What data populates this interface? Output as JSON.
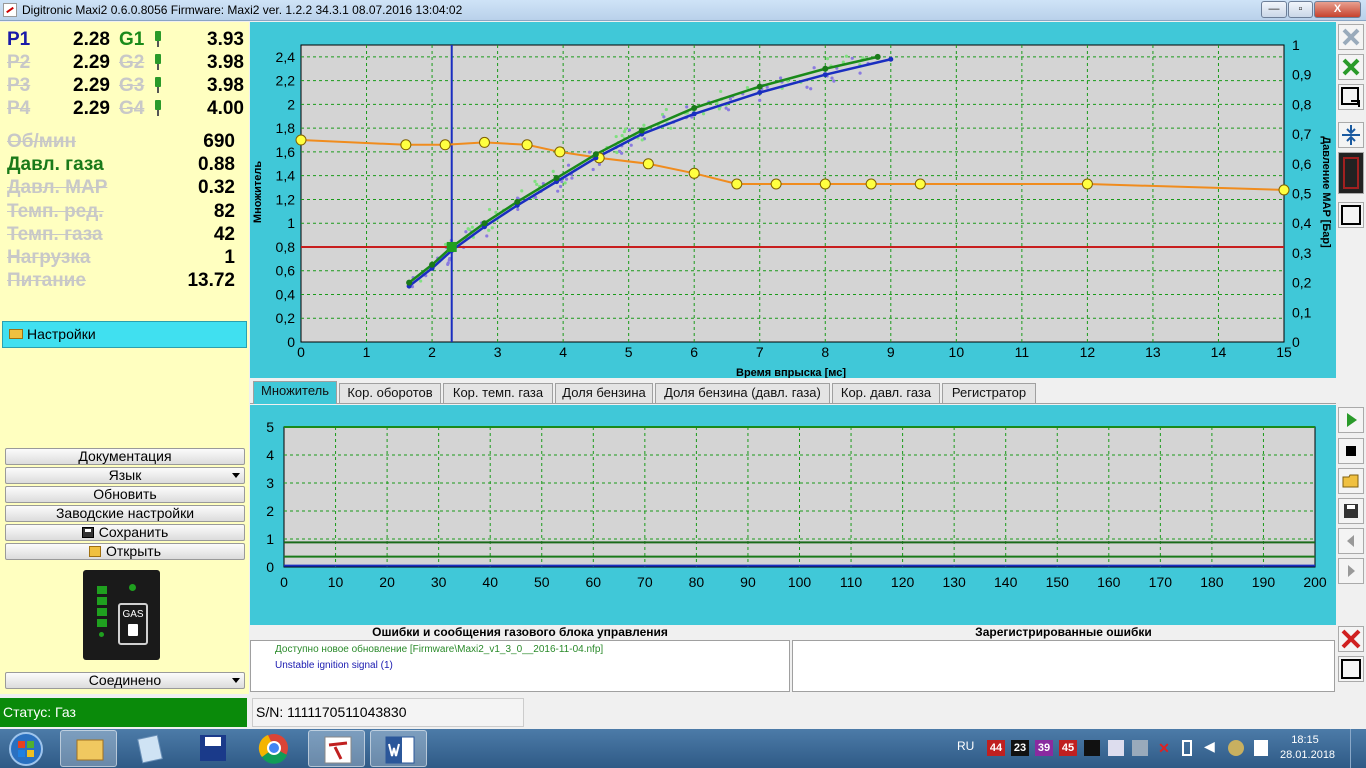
{
  "window": {
    "title": "Digitronic Maxi2 0.6.0.8056 Firmware: Maxi2  ver. 1.2.2  34.3.1  08.07.2016 13:04:02",
    "minimize": "—",
    "maximize": "▫",
    "close": "X"
  },
  "pressures": [
    {
      "label": "P1",
      "value": "2.28",
      "g_label": "G1",
      "g_value": "3.93"
    },
    {
      "label": "P2",
      "value": "2.29",
      "g_label": "G2",
      "g_value": "3.98"
    },
    {
      "label": "P3",
      "value": "2.29",
      "g_label": "G3",
      "g_value": "3.98"
    },
    {
      "label": "P4",
      "value": "2.29",
      "g_label": "G4",
      "g_value": "4.00"
    }
  ],
  "params": [
    {
      "label": "Об/мин",
      "value": "690"
    },
    {
      "label": "Давл. газа",
      "value": "0.88"
    },
    {
      "label": "Давл. MAP",
      "value": "0.32"
    },
    {
      "label": "Темп. ред.",
      "value": "82"
    },
    {
      "label": "Темп. газа",
      "value": "42"
    },
    {
      "label": "Нагрузка",
      "value": "1"
    },
    {
      "label": "Питание",
      "value": "13.72"
    }
  ],
  "settings_label": "Настройки",
  "buttons": {
    "docs": "Документация",
    "language": "Язык",
    "update": "Обновить",
    "factory": "Заводские настройки",
    "save": "Сохранить",
    "open": "Открыть",
    "connection": "Соединено"
  },
  "gas_switch_label": "GAS",
  "tabs": [
    "Множитель",
    "Кор. оборотов",
    "Кор. темп. газа",
    "Доля бензина",
    "Доля бензина (давл. газа)",
    "Кор. давл. газа",
    "Регистратор"
  ],
  "errors": {
    "left_header": "Ошибки и сообщения газового блока управления",
    "right_header": "Зарегистрированные ошибки",
    "messages": [
      "Доступно новое обновление [Firmware\\Maxi2_v1_3_0__2016-11-04.nfp]",
      "Unstable ignition signal (1)"
    ]
  },
  "status": {
    "state": "Статус: Газ",
    "serial": "S/N: 1111170511043830"
  },
  "taskbar": {
    "lang": "RU",
    "tray_temps": [
      "44",
      "23",
      "39",
      "45"
    ],
    "time": "18:15",
    "date": "28.01.2018"
  },
  "colors": {
    "panel_bg": "#40c8d8",
    "left_bg": "#ffffc0",
    "status_gas": "#0a8a0a",
    "orange_curve": "#f08c1e",
    "blue_curve": "#1a2ec0",
    "green_curve": "#1a8a1a",
    "red_line": "#c81e1e"
  },
  "chart_data": [
    {
      "type": "scatter",
      "xlabel": "Время впрыска [мс]",
      "ylabel": "Множитель",
      "y2label": "Давление MAP [Бар]",
      "xlim": [
        0,
        15
      ],
      "ylim": [
        0,
        2.5
      ],
      "y2lim": [
        0,
        1
      ],
      "grid": true,
      "xticks": [
        0,
        1,
        2,
        3,
        4,
        5,
        6,
        7,
        8,
        9,
        10,
        11,
        12,
        13,
        14,
        15
      ],
      "yticks": [
        0,
        0.2,
        0.4,
        0.6,
        0.8,
        1,
        1.2,
        1.4,
        1.6,
        1.8,
        2,
        2.2,
        2.4
      ],
      "y2ticks": [
        0,
        0.1,
        0.2,
        0.3,
        0.4,
        0.5,
        0.6,
        0.7,
        0.8,
        0.9,
        1
      ],
      "cursor_x": 2.3,
      "reference_y": 0.8,
      "series": [
        {
          "values_x": [
            0,
            1.6,
            2.2,
            2.8,
            3.45,
            3.95,
            4.55,
            5.3,
            6.0,
            6.65,
            7.25,
            8.0,
            8.7,
            9.45,
            12.0,
            15.0
          ],
          "values_y": [
            1.7,
            1.66,
            1.66,
            1.68,
            1.66,
            1.6,
            1.55,
            1.5,
            1.42,
            1.33,
            1.33,
            1.33,
            1.33,
            1.33,
            1.33,
            1.28
          ]
        },
        {
          "values_x": [
            1.65,
            2.0,
            2.3,
            2.8,
            3.3,
            3.9,
            4.5,
            5.2,
            6.0,
            7.0,
            8.0,
            9.0
          ],
          "values_y": [
            0.47,
            0.62,
            0.77,
            0.97,
            1.15,
            1.35,
            1.55,
            1.75,
            1.92,
            2.1,
            2.25,
            2.38
          ]
        },
        {
          "values_x": [
            1.65,
            2.0,
            2.3,
            2.8,
            3.3,
            3.9,
            4.5,
            5.2,
            6.0,
            7.0,
            8.0,
            8.8
          ],
          "values_y": [
            0.5,
            0.65,
            0.8,
            1.0,
            1.18,
            1.38,
            1.58,
            1.78,
            1.97,
            2.15,
            2.3,
            2.4
          ]
        }
      ]
    },
    {
      "type": "line",
      "xlim": [
        0,
        200
      ],
      "ylim": [
        0,
        5
      ],
      "xticks": [
        0,
        10,
        20,
        30,
        40,
        50,
        60,
        70,
        80,
        90,
        100,
        110,
        120,
        130,
        140,
        150,
        160,
        170,
        180,
        190,
        200
      ],
      "yticks": [
        0,
        1,
        2,
        3,
        4,
        5
      ],
      "series": [
        {
          "values_x": [
            0,
            200
          ],
          "values_y": [
            5,
            5
          ]
        },
        {
          "values_x": [
            0,
            200
          ],
          "values_y": [
            0.88,
            0.88
          ]
        },
        {
          "values_x": [
            0,
            200
          ],
          "values_y": [
            0.37,
            0.37
          ]
        },
        {
          "values_x": [
            0,
            200
          ],
          "values_y": [
            0.05,
            0.05
          ]
        }
      ]
    }
  ]
}
